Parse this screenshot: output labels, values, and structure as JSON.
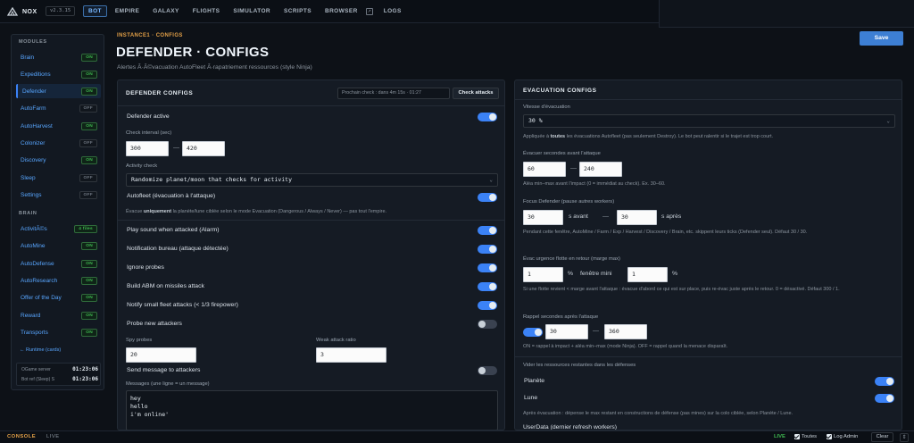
{
  "app": {
    "name": "NOX",
    "version": "v2.3.15"
  },
  "nav": [
    "BOT",
    "EMPIRE",
    "GALAXY",
    "FLIGHTS",
    "SIMULATOR",
    "SCRIPTS",
    "BROWSER",
    "LOGS"
  ],
  "sidebar": {
    "modules_heading": "MODULES",
    "modules": [
      {
        "label": "Brain",
        "state": "ON"
      },
      {
        "label": "Expeditions",
        "state": "ON"
      },
      {
        "label": "Defender",
        "state": "ON",
        "active": true
      },
      {
        "label": "AutoFarm",
        "state": "OFF"
      },
      {
        "label": "AutoHarvest",
        "state": "ON"
      },
      {
        "label": "Colonizer",
        "state": "OFF"
      },
      {
        "label": "Discovery",
        "state": "ON"
      },
      {
        "label": "Sleep",
        "state": "OFF"
      },
      {
        "label": "Settings",
        "state": "OFF"
      }
    ],
    "brain_heading": "BRAIN",
    "brain": [
      {
        "label": "ActivitÃ©s",
        "state": "4 files"
      },
      {
        "label": "AutoMine",
        "state": "ON"
      },
      {
        "label": "AutoDefense",
        "state": "ON"
      },
      {
        "label": "AutoResearch",
        "state": "ON"
      },
      {
        "label": "Offer of the Day",
        "state": "ON"
      },
      {
        "label": "Reward",
        "state": "ON"
      },
      {
        "label": "Transports",
        "state": "ON"
      }
    ],
    "runtime_link": "← Runtime (cards)",
    "runtime": [
      {
        "label": "OGame server",
        "value": "01:23:06"
      },
      {
        "label": "Bot ref (Sleep) S",
        "value": "01:23:06"
      }
    ]
  },
  "header": {
    "breadcrumb": "INSTANCE1 · CONFIGS",
    "title": "DEFENDER · CONFIGS",
    "subtitle": "Alertes Ã·Ã©vacuation AutoFleet Ã·rapatriement ressources (style Ninja)",
    "save_label": "Save"
  },
  "defender": {
    "title": "DEFENDER CONFIGS",
    "next_check": "Prochain check : dans 4m 15s · 01:27",
    "check_attacks": "Check attacks",
    "defender_active": {
      "label": "Defender active",
      "on": true
    },
    "check_interval": {
      "label": "Check interval (sec)",
      "min": "300",
      "max": "420"
    },
    "activity_check": {
      "label": "Activity check",
      "value": "Randomize planet/moon that checks for activity"
    },
    "autofleet": {
      "label": "Autofleet (évacuation à l'attaque)",
      "on": true,
      "help_pre": "Évacue ",
      "help_bold": "uniquement",
      "help_post": " la planète/lune ciblée selon le mode Evacuation (Dangerous / Always / Never) — pas tout l'empire."
    },
    "toggles": [
      {
        "label": "Play sound when attacked (Alarm)",
        "on": true
      },
      {
        "label": "Notification bureau (attaque détectée)",
        "on": true
      },
      {
        "label": "Ignore probes",
        "on": true
      },
      {
        "label": "Build ABM on missiles attack",
        "on": true
      },
      {
        "label": "Notify small fleet attacks (< 1/3 firepower)",
        "on": true
      },
      {
        "label": "Probe new attackers",
        "on": false
      }
    ],
    "spy_probes": {
      "label": "Spy probes",
      "value": "20"
    },
    "weak_ratio": {
      "label": "Weak attack ratio",
      "value": "3"
    },
    "send_message": {
      "label": "Send message to attackers",
      "on": false
    },
    "messages": {
      "label": "Messages (une ligne = un message)",
      "value": "hey\nhello\ni'm online'"
    }
  },
  "evacuation": {
    "title": "EVACUATION CONFIGS",
    "speed": {
      "label": "Vitesse d'évacuation",
      "value": "30 %",
      "help_pre": "Appliquée à ",
      "help_bold": "toutes",
      "help_post": " les évacuations Autofleet (pas seulement Destroy). Le bot peut ralentir si le trajet est trop court."
    },
    "evac_before": {
      "label": "Évacuer secondes avant l'attaque",
      "min": "60",
      "max": "240",
      "help": "Aléa min–max avant l'impact (0 = immédiat au check). Ex. 30–60."
    },
    "focus": {
      "label": "Focus Defender (pause autres workers)",
      "min": "30",
      "min_unit": "s avant",
      "max": "30",
      "max_unit": "s après",
      "help": "Pendant cette fenêtre, AutoMine / Farm / Exp / Harvest / Discovery / Brain, etc. skippent leurs ticks (Defender seul). Défaut 30 / 30."
    },
    "urgence": {
      "label": "Évac urgence flotte en retour (marge max)",
      "value": "1",
      "unit": "%",
      "window_label": "fenêtre mini",
      "window_value": "1",
      "window_unit": "%",
      "help": "Si une flotte revient < marge avant l'attaque : évacue d'abord ce qui est sur place, puis re-évac juste après le retour. 0 = désactivé. Défaut 300 / 1."
    },
    "rappel": {
      "label": "Rappel secondes après l'attaque",
      "on": true,
      "min": "30",
      "max": "360",
      "help": "ON = rappel à impact + aléa min–max (mode Ninja). OFF = rappel quand la menace disparaît."
    },
    "vider_label": "Vider les ressources restantes dans les défenses",
    "planete": {
      "label": "Planète",
      "on": true
    },
    "lune": {
      "label": "Lune",
      "on": true
    },
    "vider_help": "Après évacuation : dépense le max restant en constructions de défense (pas mines) sur la colo ciblée, selon Planète / Lune.",
    "userdata": "UserData (dernier refresh workers)"
  },
  "footer": {
    "console": "CONSOLE",
    "live_left": "LIVE",
    "live_right": "LIVE",
    "toutes": "Toutes",
    "log_admin": "Log Admin",
    "clear": "Clear"
  }
}
